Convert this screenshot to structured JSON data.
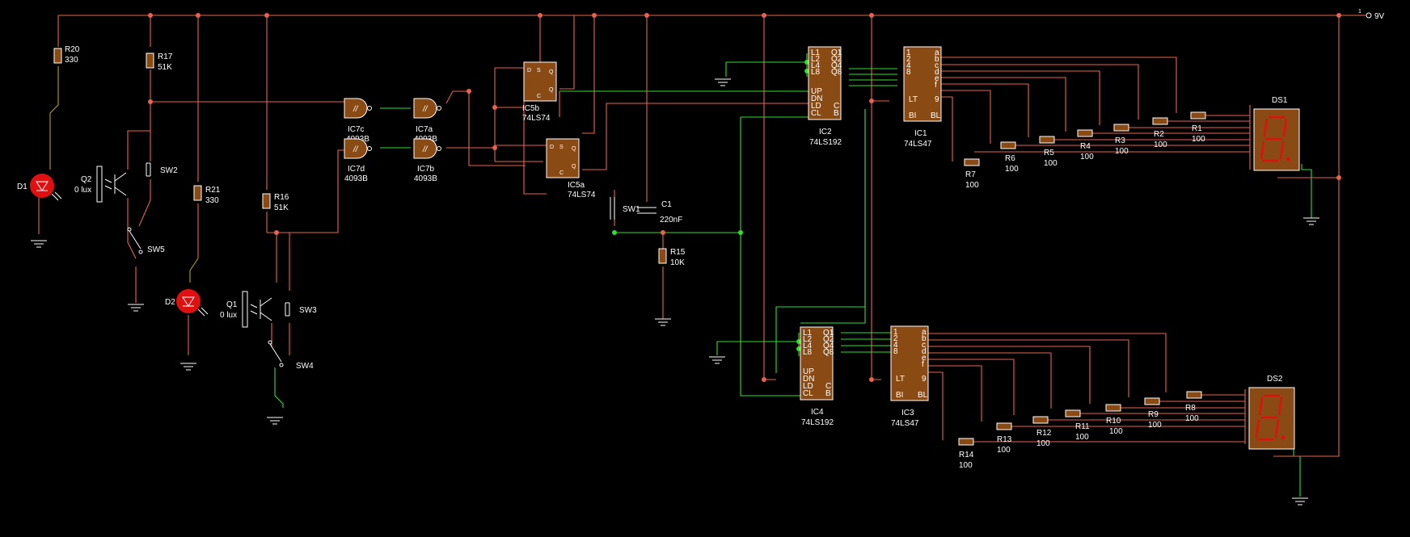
{
  "supply": {
    "label": "9V"
  },
  "leds": [
    {
      "ref": "D1"
    },
    {
      "ref": "D2"
    }
  ],
  "phototransistors": [
    {
      "ref": "Q2",
      "value": "0 lux"
    },
    {
      "ref": "Q1",
      "value": "0 lux"
    }
  ],
  "switches": [
    "SW2",
    "SW5",
    "SW3",
    "SW4",
    "SW1"
  ],
  "resistors": {
    "R20": "330",
    "R17": "51K",
    "R21": "330",
    "R16": "51K",
    "R15": "10K",
    "R1": "100",
    "R2": "100",
    "R3": "100",
    "R4": "100",
    "R5": "100",
    "R6": "100",
    "R7": "100",
    "R8": "100",
    "R9": "100",
    "R10": "100",
    "R11": "100",
    "R12": "100",
    "R13": "100",
    "R14": "100"
  },
  "capacitor": {
    "ref": "C1",
    "value": "220nF"
  },
  "gates": [
    {
      "ref": "IC7c",
      "part": "4093B"
    },
    {
      "ref": "IC7a",
      "part": "4093B"
    },
    {
      "ref": "IC7d",
      "part": "4093B"
    },
    {
      "ref": "IC7b",
      "part": "4093B"
    }
  ],
  "flipflops": [
    {
      "ref": "IC5b",
      "part": "74LS74"
    },
    {
      "ref": "IC5a",
      "part": "74LS74"
    }
  ],
  "counters": [
    {
      "ref": "IC2",
      "part": "74LS192"
    },
    {
      "ref": "IC4",
      "part": "74LS192"
    }
  ],
  "decoders": [
    {
      "ref": "IC1",
      "part": "74LS47"
    },
    {
      "ref": "IC3",
      "part": "74LS47"
    }
  ],
  "displays": [
    {
      "ref": "DS1"
    },
    {
      "ref": "DS2"
    }
  ],
  "pins": {
    "counter_left": [
      "L1",
      "L2",
      "L4",
      "L8",
      "UP",
      "DN",
      "LD",
      "CL"
    ],
    "counter_right": [
      "Q1",
      "Q2",
      "Q4",
      "Q8",
      "C",
      "B"
    ],
    "decoder_left": [
      "1",
      "2",
      "4",
      "8",
      "LT",
      "BI"
    ],
    "decoder_right": [
      "a",
      "b",
      "c",
      "d",
      "e",
      "f",
      "9"
    ],
    "decoder_bl": "BL",
    "ff": [
      "D",
      "S",
      "Q",
      "C",
      "Q"
    ]
  },
  "colors": {
    "wire": "#e8624f",
    "active_wire": "#2ee02e",
    "chip": "#8a4a14",
    "segment": "#e01010",
    "led": "#e01010"
  }
}
